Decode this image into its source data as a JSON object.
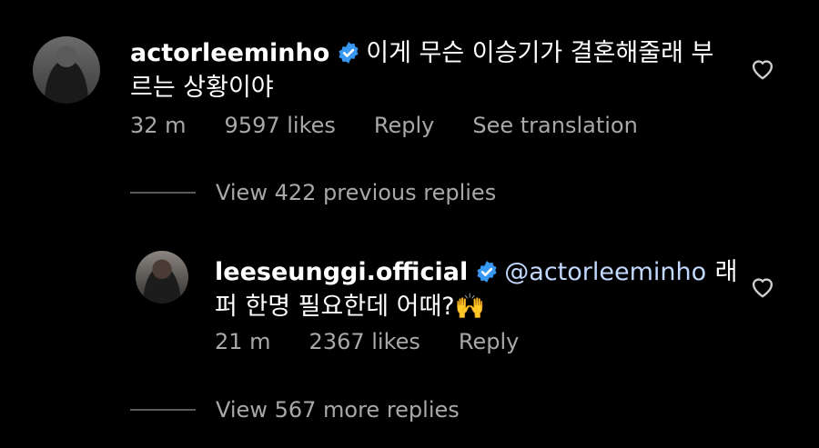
{
  "comment": {
    "author": "actorleeminho",
    "text_line1": "이게 무슨 이승기가 결혼해줄래 부",
    "text_line2": "르는 상황이야",
    "time": "32 m",
    "likes": "9597 likes",
    "reply_label": "Reply",
    "translation_label": "See translation"
  },
  "view_previous": "View 422 previous replies",
  "reply": {
    "author": "leeseunggi.official",
    "mention": "@actorleeminho",
    "text_line1_rest": "래",
    "text_line2": "퍼 한명 필요한데 어때?🙌",
    "time": "21 m",
    "likes": "2367 likes",
    "reply_label": "Reply"
  },
  "view_more": "View 567 more replies",
  "colors": {
    "background": "#000000",
    "verified": "#3897f0",
    "meta_text": "#a8a8a8"
  },
  "icons": [
    "verified-badge-icon",
    "heart-icon"
  ]
}
